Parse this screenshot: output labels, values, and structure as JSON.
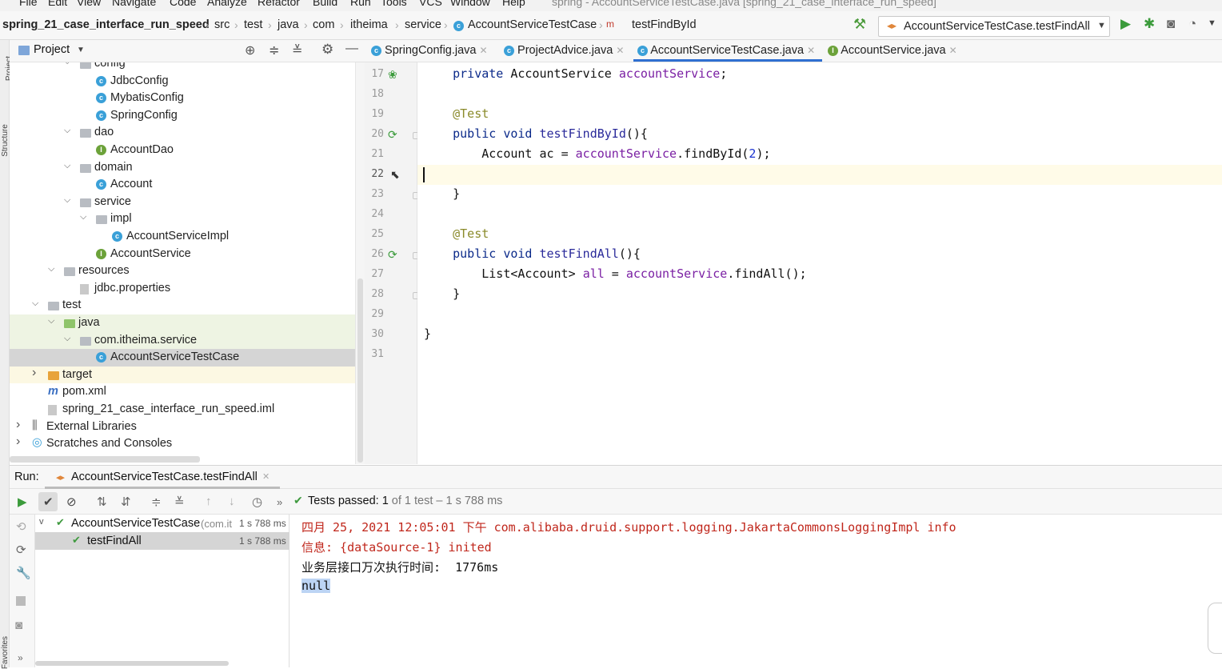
{
  "menu": {
    "items": [
      "File",
      "Edit",
      "View",
      "Navigate",
      "Code",
      "Analyze",
      "Refactor",
      "Build",
      "Run",
      "Tools",
      "VCS",
      "Window",
      "Help"
    ],
    "window_title": "spring - AccountServiceTestCase.java [spring_21_case_interface_run_speed]"
  },
  "breadcrumb": {
    "items": [
      "spring_21_case_interface_run_speed",
      "src",
      "test",
      "java",
      "com",
      "itheima",
      "service",
      "AccountServiceTestCase",
      "testFindById"
    ]
  },
  "run_config": {
    "label": "AccountServiceTestCase.testFindAll"
  },
  "project_panel": {
    "title": "Project"
  },
  "left_strip": {
    "project": "Project",
    "structure": "Structure",
    "favorites": "Favorites"
  },
  "tree": [
    {
      "label": "config",
      "type": "folder",
      "level": 3,
      "arrow": "v"
    },
    {
      "label": "JdbcConfig",
      "type": "class",
      "level": 4
    },
    {
      "label": "MybatisConfig",
      "type": "class",
      "level": 4
    },
    {
      "label": "SpringConfig",
      "type": "class",
      "level": 4
    },
    {
      "label": "dao",
      "type": "folder",
      "level": 3,
      "arrow": "v"
    },
    {
      "label": "AccountDao",
      "type": "interface",
      "level": 4
    },
    {
      "label": "domain",
      "type": "folder",
      "level": 3,
      "arrow": "v"
    },
    {
      "label": "Account",
      "type": "class",
      "level": 4
    },
    {
      "label": "service",
      "type": "folder",
      "level": 3,
      "arrow": "v"
    },
    {
      "label": "impl",
      "type": "folder",
      "level": 4,
      "arrow": "v"
    },
    {
      "label": "AccountServiceImpl",
      "type": "class",
      "level": 5
    },
    {
      "label": "AccountService",
      "type": "interface",
      "level": 4
    },
    {
      "label": "resources",
      "type": "folder",
      "level": 2,
      "arrow": "v"
    },
    {
      "label": "jdbc.properties",
      "type": "file",
      "level": 3
    },
    {
      "label": "test",
      "type": "folder",
      "level": 1,
      "arrow": "v"
    },
    {
      "label": "java",
      "type": "greenfolder",
      "level": 2,
      "arrow": "v"
    },
    {
      "label": "com.itheima.service",
      "type": "folder",
      "level": 3,
      "arrow": "v"
    },
    {
      "label": "AccountServiceTestCase",
      "type": "class",
      "level": 4
    },
    {
      "label": "target",
      "type": "yellowfolder",
      "level": 1,
      "arrow": ">"
    },
    {
      "label": "pom.xml",
      "type": "maven",
      "level": 1
    },
    {
      "label": "spring_21_case_interface_run_speed.iml",
      "type": "file",
      "level": 1
    },
    {
      "label": "External Libraries",
      "type": "lib",
      "level": 0,
      "arrow": ">"
    },
    {
      "label": "Scratches and Consoles",
      "type": "scratch",
      "level": 0,
      "arrow": ">"
    }
  ],
  "editor_tabs": [
    {
      "label": "SpringConfig.java",
      "icon": "class"
    },
    {
      "label": "ProjectAdvice.java",
      "icon": "class"
    },
    {
      "label": "AccountServiceTestCase.java",
      "icon": "class",
      "active": true
    },
    {
      "label": "AccountService.java",
      "icon": "interface"
    }
  ],
  "line_numbers": [
    "17",
    "18",
    "19",
    "20",
    "21",
    "22",
    "23",
    "24",
    "25",
    "26",
    "27",
    "28",
    "29",
    "30",
    "31"
  ],
  "code": {
    "l17_kw": "private ",
    "l17_type": "AccountService ",
    "l17_field": "accountService",
    "l17_end": ";",
    "l19": "@Test",
    "l20_kw": "public void ",
    "l20_name": "testFindById",
    "l20_end": "(){",
    "l21_a": "Account ac = ",
    "l21_field": "accountService",
    ".": ".",
    "l21_m": "findById(",
    "l21_num": "2",
    "l21_end": ");",
    "l23": "}",
    "l25": "@Test",
    "l26_kw": "public void ",
    "l26_name": "testFindAll",
    "l26_end": "(){",
    "l27_a": "List<Account> ",
    "l27_var": "all",
    " = ": " = ",
    "l27_field": "accountService",
    "l27_m": ".findAll();",
    "l28": "}",
    "l30": "}"
  },
  "run": {
    "label": "Run:",
    "tab": "AccountServiceTestCase.testFindAll",
    "status_prefix": "Tests passed: ",
    "status_count": "1",
    "status_rest": " of 1 test – 1 s 788 ms"
  },
  "test_tree": [
    {
      "label": "AccountServiceTestCase",
      "detail": "(com.it",
      "time": "1 s 788 ms"
    },
    {
      "label": "testFindAll",
      "detail": "",
      "time": "1 s 788 ms"
    }
  ],
  "console": [
    "四月 25, 2021 12:05:01 下午 com.alibaba.druid.support.logging.JakartaCommonsLoggingImpl info",
    "信息: {dataSource-1} inited",
    "业务层接口万次执行时间:  1776ms",
    "null"
  ],
  "colors": {
    "accent": "#2f6fd1",
    "pass": "#3f9a3f",
    "run": "#3b9b3b",
    "console_error": "#c0271c"
  }
}
